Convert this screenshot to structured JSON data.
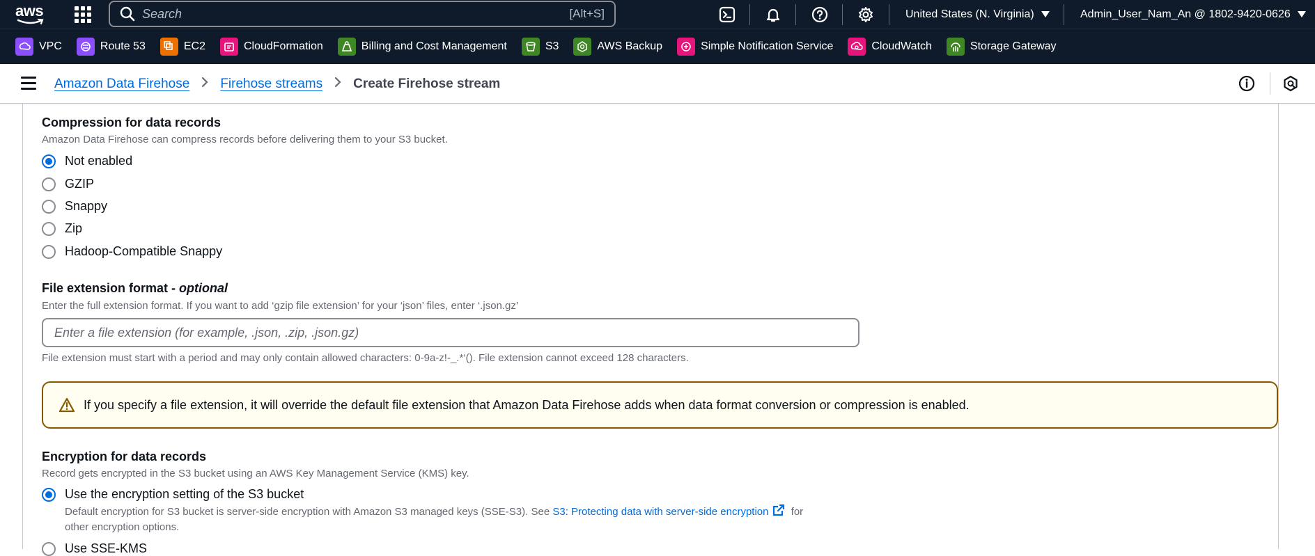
{
  "topnav": {
    "logo_text": "aws",
    "search_placeholder": "Search",
    "search_shortcut": "[Alt+S]",
    "region": "United States (N. Virginia)",
    "account": "Admin_User_Nam_An @ 1802-9420-0626",
    "icons": [
      "cloudshell-icon",
      "bell-icon",
      "help-icon",
      "settings-icon"
    ]
  },
  "favorites": [
    {
      "label": "VPC",
      "color": "#8c4fff"
    },
    {
      "label": "Route 53",
      "color": "#8c4fff"
    },
    {
      "label": "EC2",
      "color": "#ed7100"
    },
    {
      "label": "CloudFormation",
      "color": "#e7157b"
    },
    {
      "label": "Billing and Cost Management",
      "color": "#3f8624"
    },
    {
      "label": "S3",
      "color": "#3f8624"
    },
    {
      "label": "AWS Backup",
      "color": "#3f8624"
    },
    {
      "label": "Simple Notification Service",
      "color": "#e7157b"
    },
    {
      "label": "CloudWatch",
      "color": "#e7157b"
    },
    {
      "label": "Storage Gateway",
      "color": "#3f8624"
    }
  ],
  "breadcrumb": {
    "items": [
      "Amazon Data Firehose",
      "Firehose streams"
    ],
    "current": "Create Firehose stream"
  },
  "compression": {
    "title": "Compression for data records",
    "description": "Amazon Data Firehose can compress records before delivering them to your S3 bucket.",
    "options": [
      "Not enabled",
      "GZIP",
      "Snappy",
      "Zip",
      "Hadoop-Compatible Snappy"
    ],
    "selected": "Not enabled"
  },
  "file_extension": {
    "title": "File extension format - ",
    "optional": "optional",
    "description": "Enter the full extension format. If you want to add ‘gzip file extension’ for your ‘json’ files, enter ‘.json.gz’",
    "value": "",
    "placeholder": "Enter a file extension (for example, .json, .zip, .json.gz)",
    "constraint": "File extension must start with a period and may only contain allowed characters: 0-9a-z!-_.*‘(). File extension cannot exceed 128 characters."
  },
  "alert": {
    "text": "If you specify a file extension, it will override the default file extension that Amazon Data Firehose adds when data format conversion or compression is enabled."
  },
  "encryption": {
    "title": "Encryption for data records",
    "description": "Record gets encrypted in the S3 bucket using an AWS Key Management Service (KMS) key.",
    "option1_label": "Use the encryption setting of the S3 bucket",
    "option1_desc_pre": "Default encryption for S3 bucket is server-side encryption with Amazon S3 managed keys (SSE-S3). See ",
    "option1_link": "S3: Protecting data with server-side encryption",
    "option1_desc_post": " for",
    "option1_desc_line2": "other encryption options.",
    "option2_label": "Use SSE-KMS"
  },
  "colors": {
    "accent": "#006ce0",
    "nav_bg": "#0f1b2a",
    "warning_border": "#855900",
    "warning_bg": "#fffef0"
  }
}
